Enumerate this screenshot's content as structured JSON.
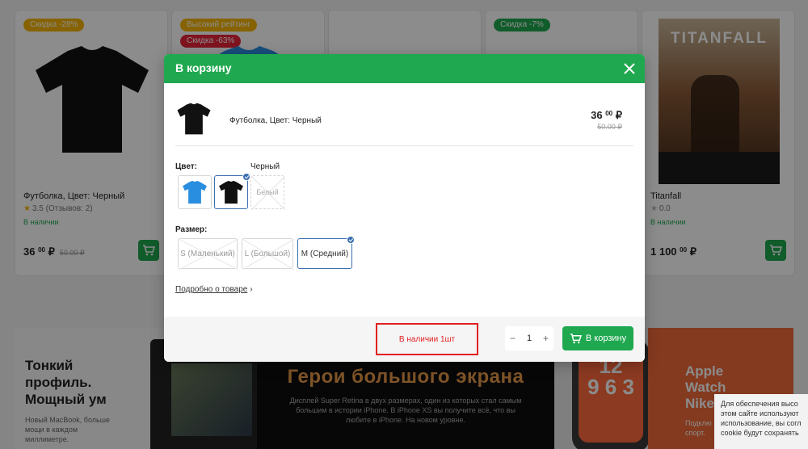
{
  "products": [
    {
      "badges": [
        "Скидка -28%"
      ],
      "name": "Футболка, Цвет: Черный",
      "rating": "3.5 (Отзывов: 2)",
      "stock": "В наличии",
      "price_int": "36",
      "price_dec": "00",
      "currency": "₽",
      "old_price": "50.00 ₽"
    },
    {
      "badges": [
        "Высокий рейтинг",
        "Скидка -63%"
      ]
    },
    {
      "badges": []
    },
    {
      "badges": [
        "Скидка -7%"
      ]
    },
    {
      "badges": [],
      "name": "Titanfall",
      "rating": "0.0",
      "stock": "В наличии",
      "price_int": "1 100",
      "price_dec": "00",
      "currency": "₽",
      "cover_title": "TITANFALL"
    }
  ],
  "banners": {
    "left": {
      "title": "Тонкий\nпрофиль.\nМощный ум",
      "text": "Новый MacBook, больше\nмощи в каждом\nмиллиметре."
    },
    "mid": {
      "title": "Герои большого экрана",
      "text": "Дисплей Super Retina в двух размерах, один из которых стал самым большим в истории iPhone. В iPhone XS вы получите всё, что вы любите в iPhone. На новом уровне."
    },
    "watch_face": "12\n9 6 3",
    "right": {
      "title": "Apple\nWatch\nNike",
      "text": "Подклю\nспорт."
    }
  },
  "cookie": "Для обеспечения высо\nэтом сайте используют\nиспользование, вы согл\ncookie будут сохранять",
  "modal": {
    "title": "В корзину",
    "item": {
      "name": "Футболка, Цвет: Черный",
      "price_int": "36",
      "price_dec": "00",
      "currency": "₽",
      "old_price": "50.00 ₽"
    },
    "color": {
      "label": "Цвет:",
      "selected": "Черный",
      "disabled_option": "Белый"
    },
    "size": {
      "label": "Размер:",
      "options": [
        "S (Маленький)",
        "L (Большой)",
        "M (Средний)"
      ]
    },
    "more_link": "Подробно о товаре",
    "stock_text": "В наличии 1шт",
    "quantity": "1",
    "add_button": "В корзину"
  },
  "colors": {
    "accent": "#1fa84f",
    "selected": "#3a6fb0",
    "alert": "#e02020"
  }
}
